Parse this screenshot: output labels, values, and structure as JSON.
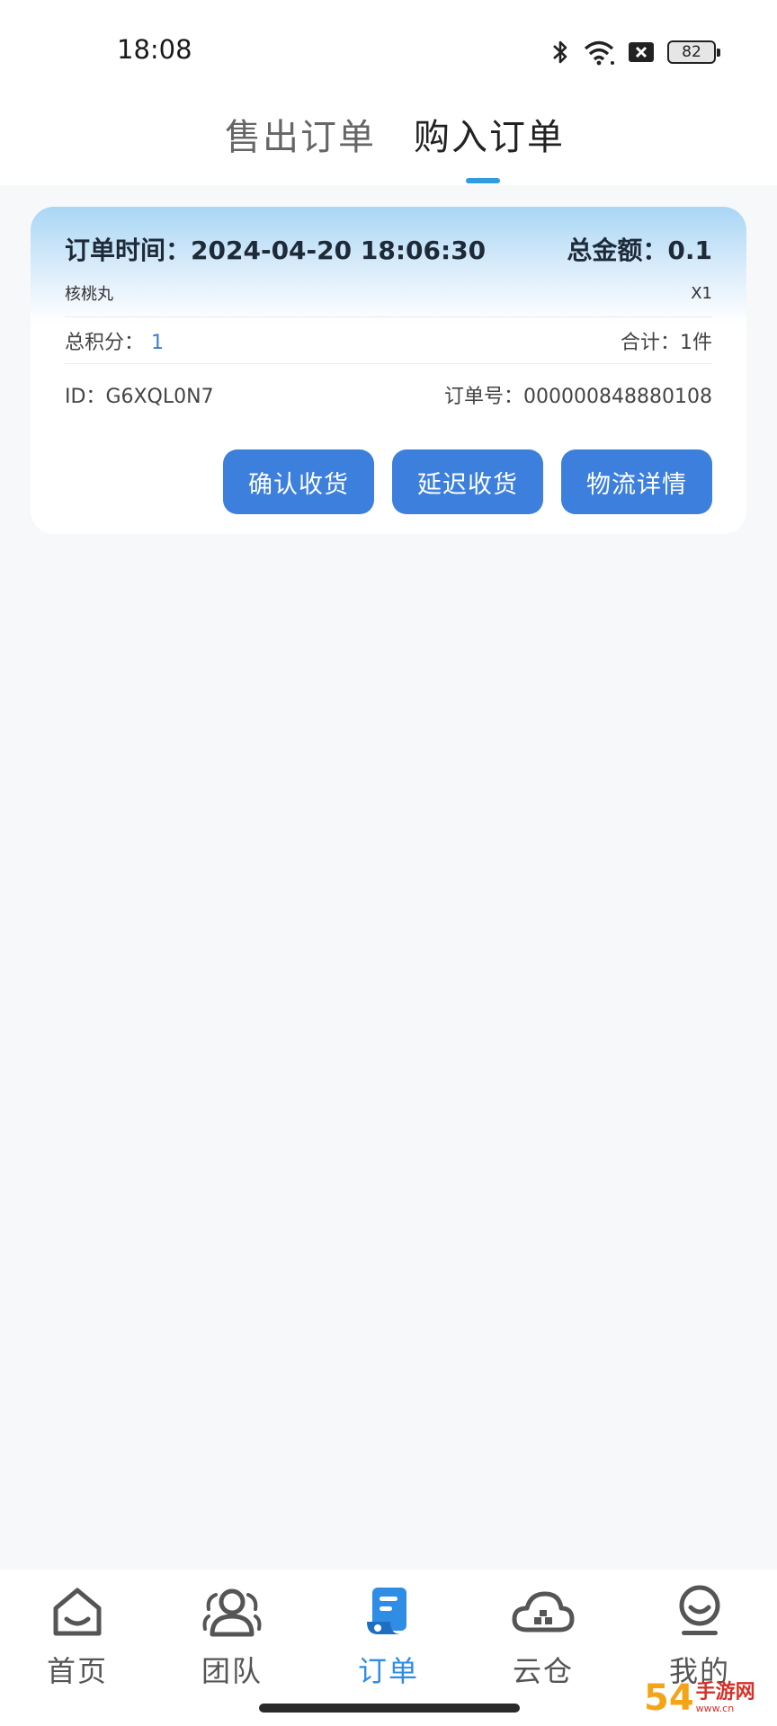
{
  "status_bar": {
    "time": "18:08",
    "battery": "82"
  },
  "tabs": [
    {
      "label": "售出订单",
      "active": false
    },
    {
      "label": "购入订单",
      "active": true
    }
  ],
  "order": {
    "time_label": "订单时间：",
    "time_value": "2024-04-20 18:06:30",
    "total_label": "总金额：",
    "total_value": "0.1",
    "product_name": "核桃丸",
    "quantity": "X1",
    "points_label": "总积分：",
    "points_value": "1",
    "count_label": "合计：",
    "count_value": "1件",
    "id_label": "ID：",
    "id_value": "G6XQL0N7",
    "order_no_label": "订单号：",
    "order_no_value": "000000848880108",
    "buttons": {
      "confirm": "确认收货",
      "delay": "延迟收货",
      "logistics": "物流详情"
    }
  },
  "bottom_nav": [
    {
      "label": "首页",
      "icon": "home-icon",
      "active": false
    },
    {
      "label": "团队",
      "icon": "team-icon",
      "active": false
    },
    {
      "label": "订单",
      "icon": "order-icon",
      "active": true
    },
    {
      "label": "云仓",
      "icon": "cloud-warehouse-icon",
      "active": false
    },
    {
      "label": "我的",
      "icon": "profile-icon",
      "active": false
    }
  ],
  "watermark": {
    "number": "54",
    "text": "手游网",
    "domain": "www.cn"
  },
  "colors": {
    "accent": "#2f8de6",
    "button": "#3c7fdc",
    "tab_indicator": "#2f9be0"
  }
}
